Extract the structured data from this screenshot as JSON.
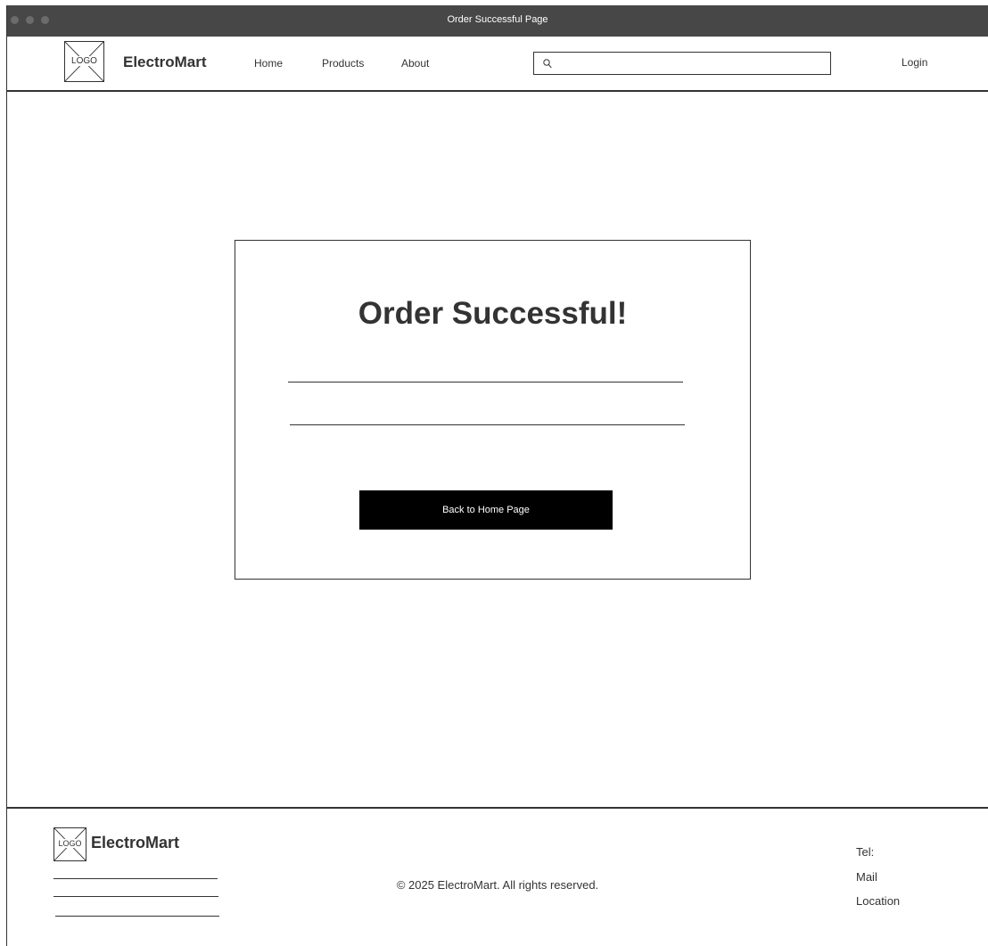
{
  "window": {
    "title": "Order Successful Page"
  },
  "nav": {
    "logo": "LOGO",
    "brand": "ElectroMart",
    "links": [
      "Home",
      "Products",
      "About"
    ],
    "search": {
      "value": "",
      "placeholder": ""
    },
    "login": "Login"
  },
  "main": {
    "heading": "Order Successful!",
    "button": "Back to Home Page"
  },
  "footer": {
    "logo": "LOGO",
    "brand": "ElectroMart",
    "copyright": "© 2025 ElectroMart. All rights reserved.",
    "contact": [
      "Tel:",
      "Mail",
      "Location"
    ]
  },
  "colors": {
    "titlebar": "#474747",
    "button": "#000000",
    "line": "#333333"
  }
}
